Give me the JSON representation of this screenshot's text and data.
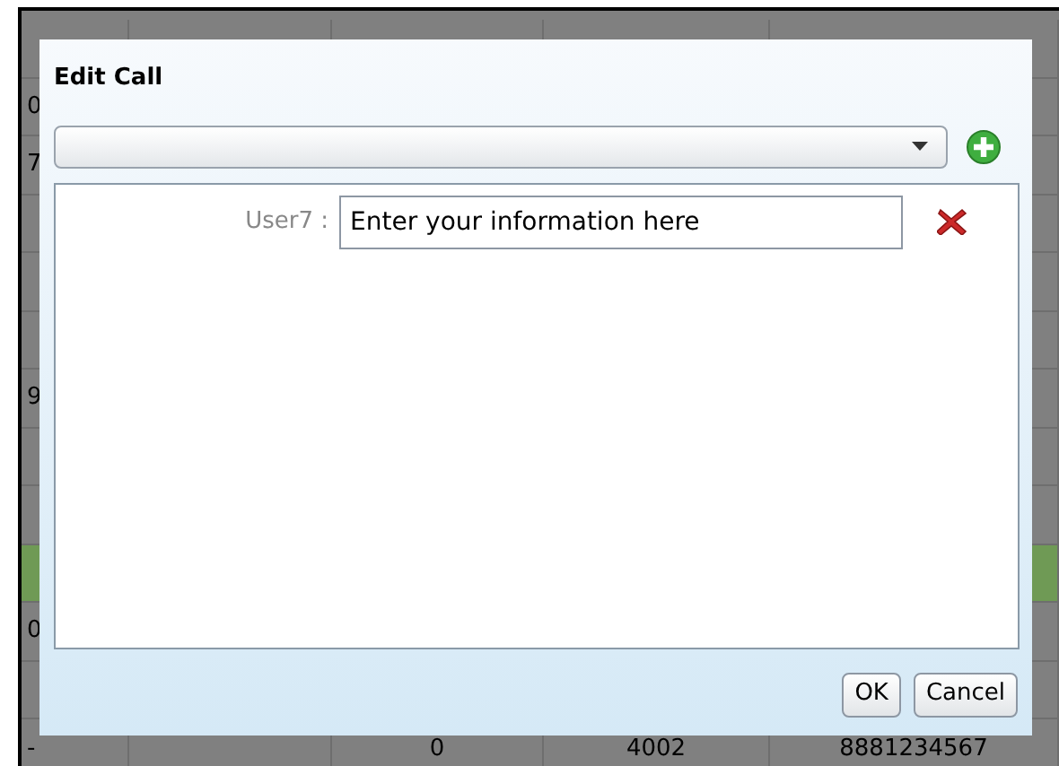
{
  "table": {
    "rows": [
      {
        "highlighted": false
      },
      {
        "highlighted": false,
        "column_1": "0"
      },
      {
        "highlighted": false,
        "column_1": "7"
      },
      {
        "highlighted": false
      },
      {
        "highlighted": false
      },
      {
        "highlighted": false
      },
      {
        "highlighted": false,
        "column_1": "9"
      },
      {
        "highlighted": false
      },
      {
        "highlighted": false
      },
      {
        "highlighted": true
      },
      {
        "highlighted": false,
        "column_1": "0"
      },
      {
        "highlighted": false
      },
      {
        "highlighted": false,
        "column_1": "-",
        "column_3": "0",
        "column_4": "4002",
        "column_5": "8881234567"
      }
    ]
  },
  "dialog": {
    "title": "Edit Call",
    "fields": [
      {
        "label": "User7 :",
        "value": "Enter your information here"
      }
    ],
    "buttons": [
      "OK",
      "Cancel"
    ]
  }
}
